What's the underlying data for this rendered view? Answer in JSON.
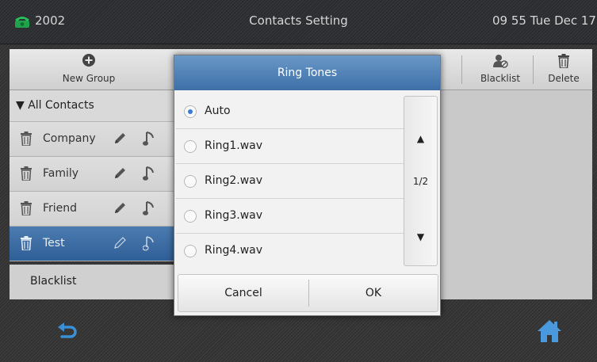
{
  "status": {
    "extension": "2002",
    "title": "Contacts Setting",
    "time": "09 55 Tue Dec 17"
  },
  "toolbar": {
    "new_group": "New Group",
    "blacklist": "Blacklist",
    "delete": "Delete"
  },
  "groups": {
    "header": "All Contacts",
    "items": [
      {
        "name": "Company"
      },
      {
        "name": "Family"
      },
      {
        "name": "Friend"
      },
      {
        "name": "Test"
      }
    ],
    "blacklist": "Blacklist"
  },
  "dialog": {
    "title": "Ring Tones",
    "options": [
      "Auto",
      "Ring1.wav",
      "Ring2.wav",
      "Ring3.wav",
      "Ring4.wav"
    ],
    "selected": "Auto",
    "page": "1/2",
    "up_glyph": "▲",
    "down_glyph": "▼",
    "cancel": "Cancel",
    "ok": "OK"
  },
  "colors": {
    "accent": "#3e6fa7",
    "selected_row": "#2f5f97",
    "radio_checked": "#3a7bd5"
  },
  "icons": [
    "phone-icon",
    "add-icon",
    "blacklist-user-icon",
    "trash-icon",
    "pencil-icon",
    "music-note-icon",
    "back-icon",
    "home-icon"
  ]
}
